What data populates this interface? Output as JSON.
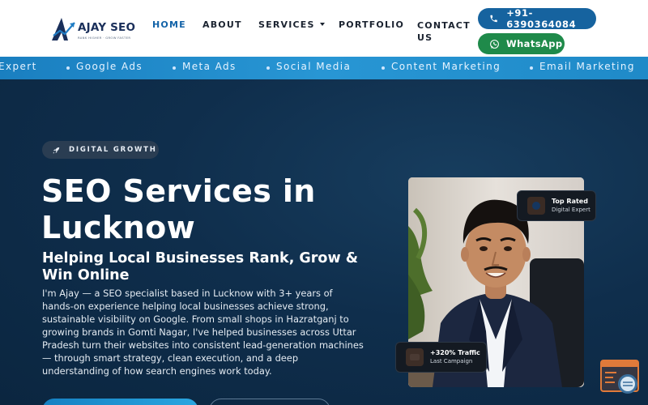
{
  "header": {
    "logo": {
      "brand": "AJAY SEO",
      "brand_part1": "AJAY",
      "brand_part2": "SEO",
      "tagline": "RANK HIGHER · GROW FASTER"
    },
    "nav": [
      {
        "label": "HOME",
        "active": true
      },
      {
        "label": "ABOUT",
        "active": false
      },
      {
        "label": "SERVICES",
        "active": false,
        "has_dropdown": true
      },
      {
        "label": "PORTFOLIO",
        "active": false
      },
      {
        "label": "CONTACT US",
        "active": false
      }
    ],
    "phone_button": {
      "label": "+91-6390364084",
      "icon": "phone-icon",
      "color": "#16639f"
    },
    "whatsapp_button": {
      "label": "WhatsApp",
      "icon": "whatsapp-icon",
      "color": "#1f8a4a"
    }
  },
  "ticker": {
    "items": [
      "Expert",
      "Google Ads",
      "Meta Ads",
      "Social Media",
      "Content Marketing",
      "Email Marketing"
    ]
  },
  "hero": {
    "badge": {
      "label": "DIGITAL GROWTH",
      "icon": "rocket-icon"
    },
    "title": "SEO Services in Lucknow",
    "subtitle": "Helping Local Businesses Rank, Grow & Win Online",
    "paragraph": "I'm Ajay — a SEO specialist based in Lucknow with 3+ years of hands-on experience helping local businesses achieve strong, sustainable visibility on Google. From small shops in Hazratganj to growing brands in Gomti Nagar, I've helped businesses across Uttar Pradesh turn their websites into consistent lead-generation machines — through smart strategy, clean execution, and a deep understanding of how search engines work today."
  },
  "cards": {
    "top": {
      "title": "Top Rated",
      "subtitle": "Digital Expert"
    },
    "bottom": {
      "title": "+320% Traffic",
      "subtitle": "Last Campaign"
    }
  },
  "colors": {
    "accent": "#1363a8",
    "hero_bg": "#0f2e4c",
    "ticker_bg": "#2896d4",
    "whatsapp": "#1f8a4a"
  }
}
